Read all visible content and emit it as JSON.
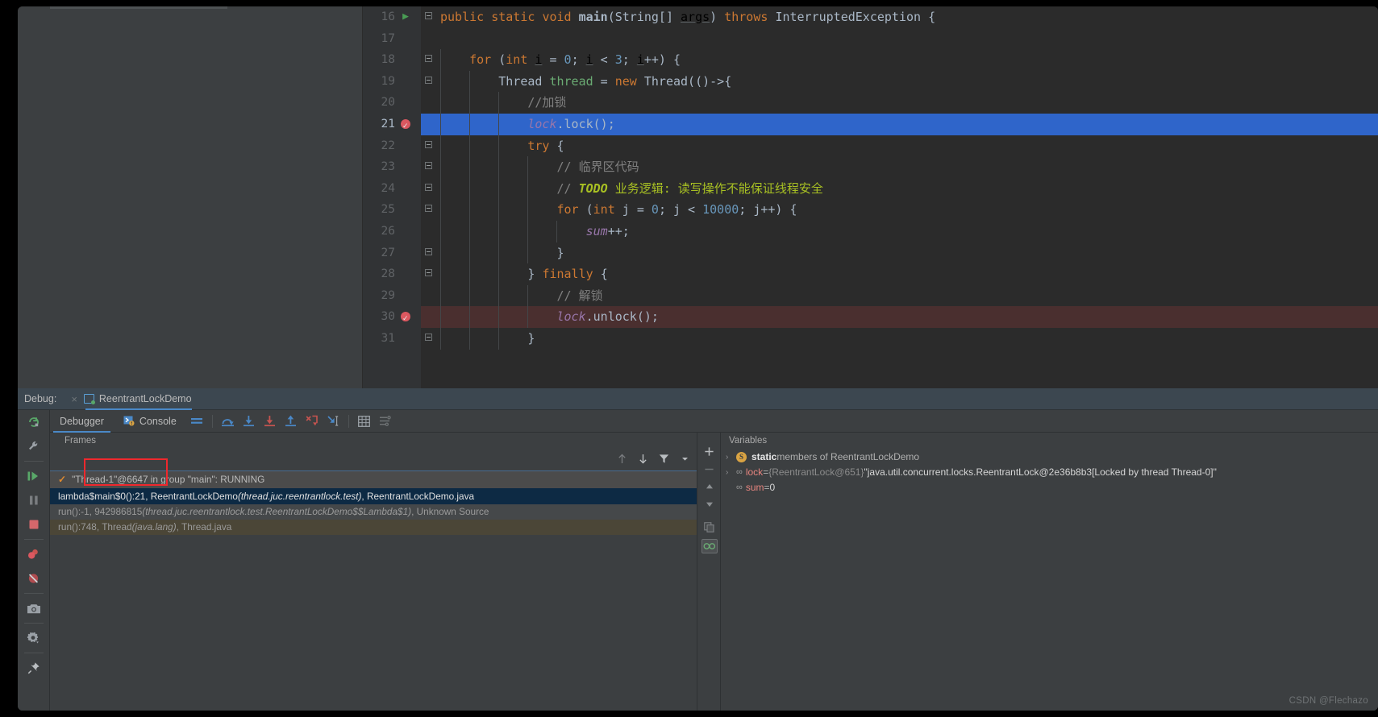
{
  "editor": {
    "lines": [
      {
        "num": "16",
        "marker": "run",
        "fold": "minus",
        "indent": 0,
        "code": [
          {
            "t": "public ",
            "c": "kw"
          },
          {
            "t": "static ",
            "c": "kw"
          },
          {
            "t": "void ",
            "c": "kw"
          },
          {
            "t": "main",
            "c": "fnb"
          },
          {
            "t": "(String[] ",
            "c": "id"
          },
          {
            "t": "args",
            "c": "und"
          },
          {
            "t": ") ",
            "c": "id"
          },
          {
            "t": "throws ",
            "c": "kw"
          },
          {
            "t": "InterruptedException {",
            "c": "id"
          }
        ]
      },
      {
        "num": "17",
        "marker": "",
        "fold": "",
        "indent": 0,
        "code": []
      },
      {
        "num": "18",
        "marker": "",
        "fold": "minus",
        "indent": 1,
        "code": [
          {
            "t": "    ",
            "c": "id"
          },
          {
            "t": "for ",
            "c": "kw"
          },
          {
            "t": "(",
            "c": "id"
          },
          {
            "t": "int ",
            "c": "kw"
          },
          {
            "t": "i",
            "c": "und"
          },
          {
            "t": " = ",
            "c": "id"
          },
          {
            "t": "0",
            "c": "num2"
          },
          {
            "t": "; ",
            "c": "id"
          },
          {
            "t": "i",
            "c": "und"
          },
          {
            "t": " < ",
            "c": "id"
          },
          {
            "t": "3",
            "c": "num2"
          },
          {
            "t": "; ",
            "c": "id"
          },
          {
            "t": "i",
            "c": "und"
          },
          {
            "t": "++) {",
            "c": "id"
          }
        ]
      },
      {
        "num": "19",
        "marker": "",
        "fold": "minus",
        "indent": 2,
        "code": [
          {
            "t": "        Thread ",
            "c": "id"
          },
          {
            "t": "thread",
            "c": "grn"
          },
          {
            "t": " = ",
            "c": "id"
          },
          {
            "t": "new ",
            "c": "kw"
          },
          {
            "t": "Thread(()->{",
            "c": "id"
          }
        ]
      },
      {
        "num": "20",
        "marker": "",
        "fold": "",
        "indent": 3,
        "code": [
          {
            "t": "            //加锁",
            "c": "cmt"
          }
        ]
      },
      {
        "num": "21",
        "marker": "bp",
        "fold": "",
        "indent": 3,
        "state": "selected",
        "code": [
          {
            "t": "            ",
            "c": "id"
          },
          {
            "t": "lock",
            "c": "fld"
          },
          {
            "t": ".lock();",
            "c": "id"
          }
        ]
      },
      {
        "num": "22",
        "marker": "",
        "fold": "minus",
        "indent": 3,
        "code": [
          {
            "t": "            ",
            "c": "id"
          },
          {
            "t": "try ",
            "c": "kw"
          },
          {
            "t": "{",
            "c": "id"
          }
        ]
      },
      {
        "num": "23",
        "marker": "",
        "fold": "minus",
        "indent": 4,
        "code": [
          {
            "t": "                // 临界区代码",
            "c": "cmt"
          }
        ]
      },
      {
        "num": "24",
        "marker": "",
        "fold": "minusbox",
        "indent": 4,
        "code": [
          {
            "t": "                // ",
            "c": "cmt"
          },
          {
            "t": "TODO ",
            "c": "todo"
          },
          {
            "t": "业务逻辑: 读写操作不能保证线程安全",
            "c": "todotxt"
          }
        ]
      },
      {
        "num": "25",
        "marker": "",
        "fold": "minus",
        "indent": 4,
        "code": [
          {
            "t": "                ",
            "c": "id"
          },
          {
            "t": "for ",
            "c": "kw"
          },
          {
            "t": "(",
            "c": "id"
          },
          {
            "t": "int ",
            "c": "kw"
          },
          {
            "t": "j = ",
            "c": "id"
          },
          {
            "t": "0",
            "c": "num2"
          },
          {
            "t": "; j < ",
            "c": "id"
          },
          {
            "t": "10000",
            "c": "num2"
          },
          {
            "t": "; j++) {",
            "c": "id"
          }
        ]
      },
      {
        "num": "26",
        "marker": "",
        "fold": "",
        "indent": 5,
        "code": [
          {
            "t": "                    ",
            "c": "id"
          },
          {
            "t": "sum",
            "c": "fld"
          },
          {
            "t": "++;",
            "c": "id"
          }
        ]
      },
      {
        "num": "27",
        "marker": "",
        "fold": "minusbox",
        "indent": 4,
        "code": [
          {
            "t": "                }",
            "c": "id"
          }
        ]
      },
      {
        "num": "28",
        "marker": "",
        "fold": "minus",
        "indent": 3,
        "code": [
          {
            "t": "            } ",
            "c": "id"
          },
          {
            "t": "finally ",
            "c": "kw"
          },
          {
            "t": "{",
            "c": "id"
          }
        ]
      },
      {
        "num": "29",
        "marker": "",
        "fold": "",
        "indent": 4,
        "code": [
          {
            "t": "                // 解锁",
            "c": "cmt"
          }
        ]
      },
      {
        "num": "30",
        "marker": "bp2",
        "fold": "",
        "indent": 4,
        "state": "hit",
        "code": [
          {
            "t": "                ",
            "c": "id"
          },
          {
            "t": "lock",
            "c": "fld"
          },
          {
            "t": ".unlock();",
            "c": "id"
          }
        ]
      },
      {
        "num": "31",
        "marker": "",
        "fold": "minusbox",
        "indent": 3,
        "code": [
          {
            "t": "            }",
            "c": "id"
          }
        ]
      }
    ]
  },
  "debug_header": {
    "label": "Debug:",
    "close": "×",
    "session_name": "ReentrantLockDemo"
  },
  "toolbar": {
    "tabs": [
      {
        "label": "Debugger",
        "active": true
      },
      {
        "label": "Console",
        "active": false
      }
    ],
    "icons": [
      "layout-icon",
      "step-over-icon",
      "step-into-icon",
      "force-step-into-icon",
      "step-out-icon",
      "drop-frame-icon",
      "run-to-cursor-icon",
      "evaluate-expression-icon",
      "settings-list-icon"
    ]
  },
  "rail": {
    "icons": [
      "rerun-icon",
      "wrench-icon",
      "resume-program-icon",
      "pause-program-icon",
      "stop-icon",
      "view-breakpoints-icon",
      "mute-breakpoints-icon",
      "camera-icon",
      "settings-gear-icon",
      "pin-icon"
    ]
  },
  "frames": {
    "title": "Frames",
    "tools": [
      "arrow-up-icon",
      "arrow-down-icon",
      "filter-icon",
      "chevron-down-icon"
    ],
    "thread": {
      "check": "✓",
      "label": "\"Thread-1\"@6647 in group \"main\": RUNNING"
    },
    "rows": [
      {
        "main": "lambda$main$0():21, ReentrantLockDemo ",
        "italic": "(thread.juc.reentrantlock.test)",
        "tail": ", ReentrantLockDemo.java",
        "state": "selected"
      },
      {
        "main": "run():-1, 942986815 ",
        "italic": "(thread.juc.reentrantlock.test.ReentrantLockDemo$$Lambda$1)",
        "tail": ", Unknown Source",
        "state": "dim"
      },
      {
        "main": "run():748, Thread ",
        "italic": "(java.lang)",
        "tail": ", Thread.java",
        "state": "dim2"
      }
    ]
  },
  "variables": {
    "title": "Variables",
    "gutter_icons": [
      "add-icon",
      "remove-icon",
      "up-icon",
      "down-icon",
      "copy-icon",
      "watch-icon"
    ],
    "rows": [
      {
        "arrow": "›",
        "badge": "S",
        "name": "static",
        "name_style": "bold",
        "rest": " members of ReentrantLockDemo"
      },
      {
        "arrow": "›",
        "icon": "oo",
        "name": "lock",
        "eq": " = ",
        "type": "{ReentrantLock@651}",
        "value": " \"java.util.concurrent.locks.ReentrantLock@2e36b8b3[Locked by thread Thread-0]\""
      },
      {
        "arrow": "",
        "icon": "oo",
        "name": "sum",
        "eq": " = ",
        "type": "",
        "value": "0"
      }
    ]
  },
  "watermark": "CSDN @Flechazo",
  "colors": {
    "editor_bg": "#2b2b2b",
    "panel_bg": "#3c3f41",
    "selection": "#2f65ca",
    "breakpoint_line": "#4a2f2f",
    "accent_blue": "#4a88c7",
    "breakpoint_red": "#db5860",
    "highlight_box": "#f0282d",
    "selected_frame": "#0d2a44"
  }
}
